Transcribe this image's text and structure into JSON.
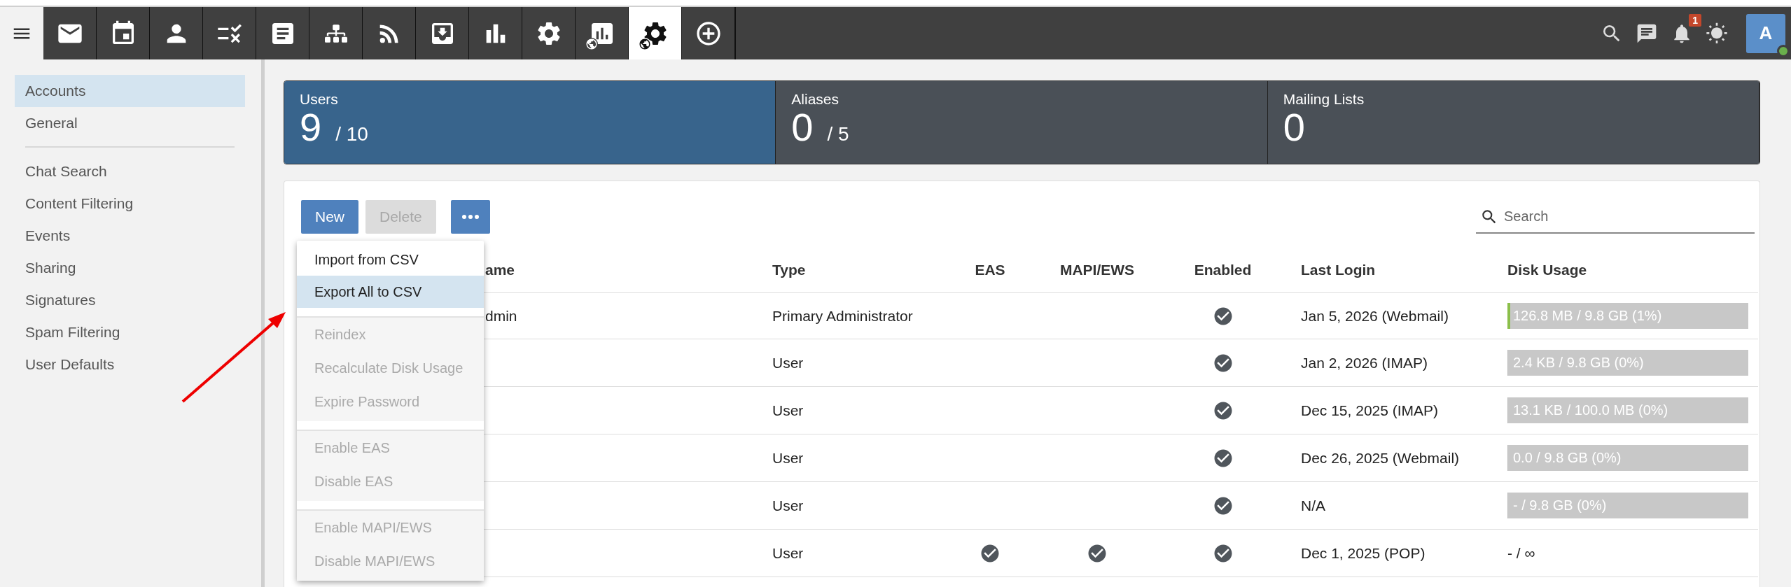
{
  "nav_tabs": [
    {
      "kind": "mail",
      "selected": false
    },
    {
      "kind": "calendar",
      "selected": false
    },
    {
      "kind": "person",
      "selected": false
    },
    {
      "kind": "tasks",
      "selected": false
    },
    {
      "kind": "notes",
      "selected": false
    },
    {
      "kind": "sitemap",
      "selected": false
    },
    {
      "kind": "rss",
      "selected": false
    },
    {
      "kind": "inbox",
      "selected": false
    },
    {
      "kind": "chart",
      "selected": false
    },
    {
      "kind": "settings",
      "selected": false
    },
    {
      "kind": "report-globe",
      "selected": false
    },
    {
      "kind": "settings-globe",
      "selected": true
    },
    {
      "kind": "add",
      "selected": false
    }
  ],
  "header_actions": {
    "notification_count": "1",
    "avatar": {
      "initial": "A",
      "online": true
    }
  },
  "sidebar": {
    "groups": [
      [
        {
          "label": "Accounts",
          "selected": true
        },
        {
          "label": "General",
          "selected": false
        }
      ],
      [
        {
          "label": "Chat Search",
          "selected": false
        },
        {
          "label": "Content Filtering",
          "selected": false
        },
        {
          "label": "Events",
          "selected": false
        },
        {
          "label": "Sharing",
          "selected": false
        },
        {
          "label": "Signatures",
          "selected": false
        },
        {
          "label": "Spam Filtering",
          "selected": false
        },
        {
          "label": "User Defaults",
          "selected": false
        }
      ]
    ]
  },
  "stats": [
    {
      "label": "Users",
      "value": "9",
      "total": "/ 10",
      "selected": true
    },
    {
      "label": "Aliases",
      "value": "0",
      "total": "/ 5",
      "selected": false
    },
    {
      "label": "Mailing Lists",
      "value": "0",
      "selected": false
    }
  ],
  "toolbar": {
    "buttons": [
      {
        "kind": "text",
        "label": "New",
        "disabled": false
      },
      {
        "kind": "text",
        "label": "Delete",
        "disabled": true
      },
      {
        "kind": "more",
        "disabled": false
      }
    ],
    "search": {
      "placeholder": "Search"
    }
  },
  "menu": {
    "groups": [
      {
        "disabled": false,
        "items": [
          {
            "label": "Import from CSV",
            "selected": false
          },
          {
            "label": "Export All to CSV",
            "selected": true
          }
        ]
      },
      {
        "disabled": true,
        "items": [
          {
            "label": "Reindex",
            "selected": false
          },
          {
            "label": "Recalculate Disk Usage",
            "selected": false
          },
          {
            "label": "Expire Password",
            "selected": false
          }
        ]
      },
      {
        "disabled": true,
        "items": [
          {
            "label": "Enable EAS",
            "selected": false
          },
          {
            "label": "Disable EAS",
            "selected": false
          }
        ]
      },
      {
        "disabled": true,
        "items": [
          {
            "label": "Enable MAPI/EWS",
            "selected": false
          },
          {
            "label": "Disable MAPI/EWS",
            "selected": false
          }
        ]
      }
    ]
  },
  "table": {
    "columns": [
      "ame",
      "Type",
      "EAS",
      "MAPI/EWS",
      "Enabled",
      "Last Login",
      "Disk Usage"
    ],
    "rows": [
      {
        "name": "dmin",
        "type": "Primary Administrator",
        "eas": false,
        "mapi": false,
        "enabled": true,
        "last_login": "Jan 5, 2026 (Webmail)",
        "disk": {
          "kind": "bar",
          "text": "126.8 MB / 9.8 GB (1%)",
          "level": 0.01
        }
      },
      {
        "type": "User",
        "eas": false,
        "mapi": false,
        "enabled": true,
        "last_login": "Jan 2, 2026 (IMAP)",
        "disk": {
          "kind": "bar",
          "text": "2.4 KB / 9.8 GB (0%)",
          "level": 0
        }
      },
      {
        "type": "User",
        "eas": false,
        "mapi": false,
        "enabled": true,
        "last_login": "Dec 15, 2025 (IMAP)",
        "disk": {
          "kind": "bar",
          "text": "13.1 KB / 100.0 MB (0%)",
          "level": 0
        }
      },
      {
        "type": "User",
        "eas": false,
        "mapi": false,
        "enabled": true,
        "last_login": "Dec 26, 2025 (Webmail)",
        "disk": {
          "kind": "bar",
          "text": "0.0 / 9.8 GB (0%)",
          "level": 0
        }
      },
      {
        "type": "User",
        "eas": false,
        "mapi": false,
        "enabled": true,
        "last_login": "N/A",
        "disk": {
          "kind": "bar",
          "text": "- / 9.8 GB (0%)",
          "level": 0
        }
      },
      {
        "type": "User",
        "eas": true,
        "mapi": true,
        "enabled": true,
        "last_login": "Dec 1, 2025 (POP)",
        "disk": {
          "kind": "text",
          "text": "- / ∞"
        }
      }
    ]
  }
}
